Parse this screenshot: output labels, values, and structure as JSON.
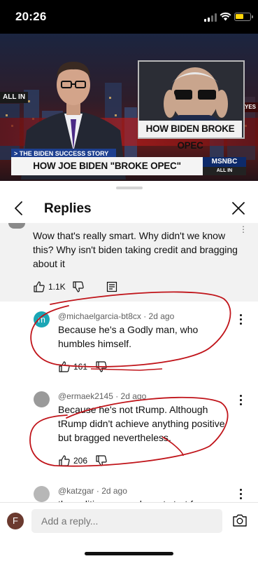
{
  "status_bar": {
    "time": "20:26"
  },
  "video": {
    "inset_banner": "HOW BIDEN BROKE OPEC",
    "chyron_top": "> THE BIDEN SUCCESS STORY",
    "chyron_main": "HOW JOE BIDEN \"BROKE OPEC\"",
    "network": "MSNBC",
    "show_logo": "ALL IN",
    "show_logo_left": "ALL IN",
    "show_logo_right": "HAYES"
  },
  "sheet": {
    "title": "Replies"
  },
  "parent_comment": {
    "text": "Wow that's really smart. Why didn't we know this? Why isn't biden taking credit and bragging about it",
    "likes": "1.1K"
  },
  "replies": [
    {
      "avatar_letter": "m",
      "avatar_color": "#1ba6b5",
      "handle": "@michaelgarcia-bt8cx · 2d ago",
      "text": "Because he's a Godly man, who humbles himself.",
      "likes": "161"
    },
    {
      "avatar_letter": "",
      "avatar_color": "#9a9a9a",
      "handle": "@ermaek2145 · 2d ago",
      "text": "Because he's not tRump. Although tRump didn't achieve anything positive but bragged nevertheless.",
      "likes": "206"
    },
    {
      "avatar_letter": "",
      "avatar_color": "#b7b7b7",
      "handle": "@katzgar · 2d ago",
      "text": "the politic season doesnt start for a",
      "likes": ""
    }
  ],
  "composer": {
    "avatar_letter": "F",
    "placeholder": "Add a reply..."
  },
  "colors": {
    "annotation": "#c0141a",
    "accent_avatar": "#1ba6b5"
  },
  "icons": [
    "back-arrow-icon",
    "close-icon",
    "thumb-up-icon",
    "thumb-down-icon",
    "reply-icon",
    "more-vert-icon",
    "camera-icon"
  ]
}
